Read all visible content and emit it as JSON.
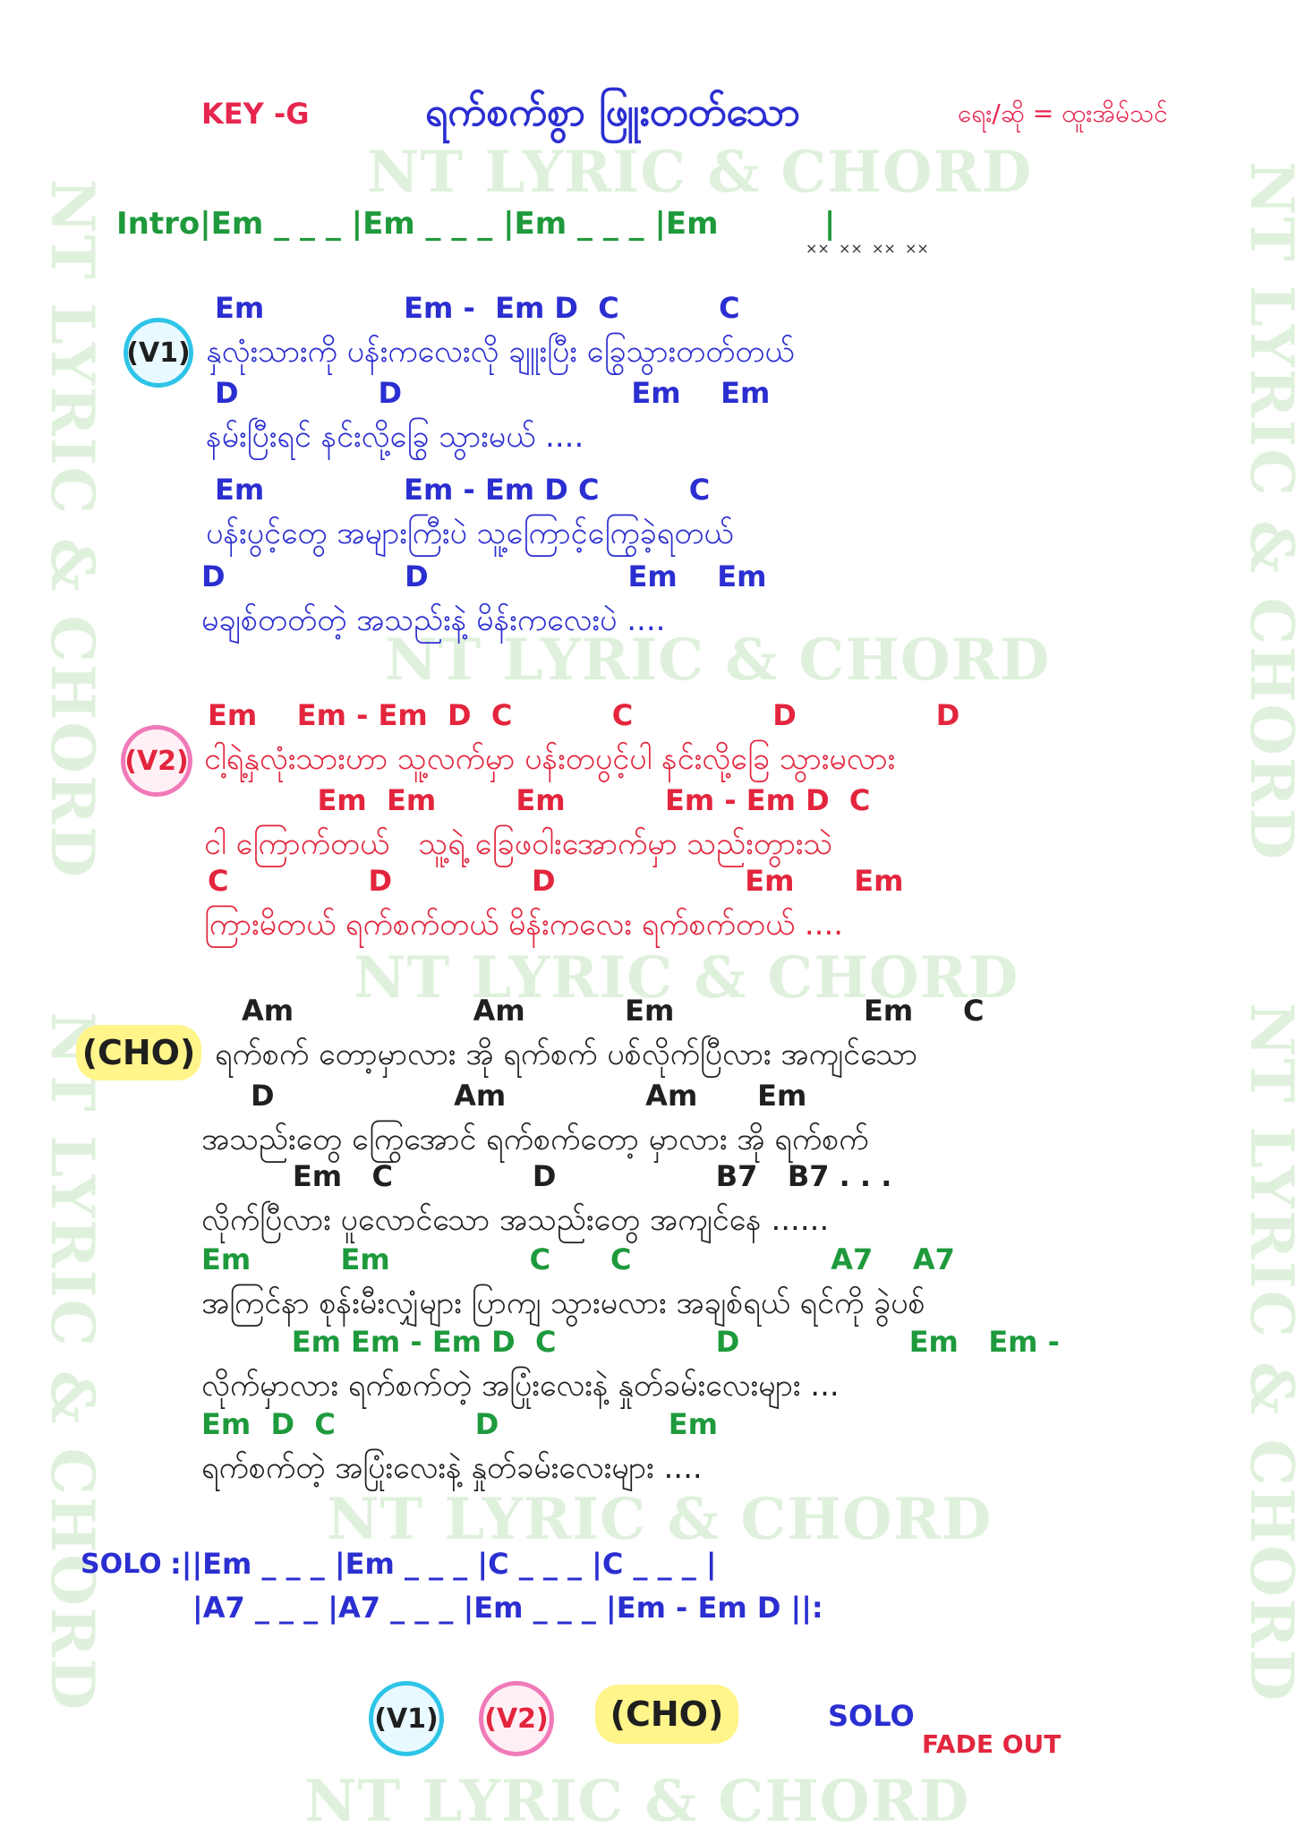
{
  "watermark": "NT LYRIC & CHORD",
  "header": {
    "key": "KEY -G",
    "title": "ရက်စက်စွာ ဖြူးတတ်သော",
    "credit": "ရေး/ဆို = ထူးအိမ်သင်"
  },
  "intro": {
    "line": "Intro|Em _ _ _ |Em _ _ _ |Em _ _ _ |Em          |"
  },
  "verse1": {
    "label": "(V1)",
    "lines": [
      {
        "chords": "Em              Em -  Em D  C          C",
        "lyric": "နှလုံးသားကို ပန်းကလေးလို ချူးပြီး ခြွေသွားတတ်တယ်"
      },
      {
        "chords": "D              D                       Em    Em",
        "lyric": "နမ်းပြီးရင် နင်းလို့ခြွေ သွားမယ် ...."
      },
      {
        "chords": "Em              Em - Em D C         C",
        "lyric": "ပန်းပွင့်တွေ အများကြီးပဲ သူ့ကြောင့်ကြွေခဲ့ရတယ်"
      },
      {
        "chords": "D                  D                    Em    Em",
        "lyric": "မချစ်တတ်တဲ့ အသည်းနဲ့ မိန်းကလေးပဲ ...."
      }
    ]
  },
  "verse2": {
    "label": "(V2)",
    "lines": [
      {
        "chords": "Em    Em - Em  D  C          C              D              D",
        "lyric": "ငါ့ရဲ့နှလုံးသားဟာ သူ့လက်မှာ ပန်းတပွင့်ပါ နင်းလို့ခြေ သွားမလား"
      },
      {
        "chords": "           Em  Em        Em          Em - Em D  C",
        "lyric": "ငါ ကြောက်တယ်   သူ့ရဲ့ ခြေဖဝါးအောက်မှာ သည်းတွားသဲ"
      },
      {
        "chords": "C              D              D                   Em      Em",
        "lyric": "ကြားမိတယ် ရက်စက်တယ် မိန်းကလေး ရက်စက်တယ် ...."
      }
    ]
  },
  "chorus": {
    "label": "(CHO)",
    "lines": [
      {
        "chords": "Am                  Am          Em                   Em     C",
        "lyric": "ရက်စက် တော့မှာလား အို ရက်စက် ပစ်လိုက်ပြီလား အကျင်သော",
        "color": "dark"
      },
      {
        "chords": "D                  Am              Am      Em",
        "lyric": "အသည်းတွေ ကြွေအောင် ရက်စက်တော့ မှာလား အို ရက်စက်",
        "color": "dark"
      },
      {
        "chords": "      Em   C              D                B7   B7 . . .",
        "lyric": "လိုက်ပြီလား ပူလောင်သော အသည်းတွေ အကျင်နေ ......",
        "color": "dark"
      },
      {
        "chords": "Em         Em              C      C                    A7    A7",
        "lyric": "အကြင်နာ စုန်းမီးလျှံများ ပြာကျ သွားမလား အချစ်ရယ် ရင်ကို ခွဲပစ်",
        "color": "green"
      },
      {
        "chords": "     Em Em - Em D  C                D                 Em   Em -",
        "lyric": "လိုက်မှာလား ရက်စက်တဲ့ အပြုံးလေးနဲ့ နှုတ်ခမ်းလေးများ ...",
        "color": "green"
      },
      {
        "chords": "Em  D  C              D                 Em",
        "lyric": "ရက်စက်တဲ့ အပြုံးလေးနဲ့ နှုတ်ခမ်းလေးများ ....",
        "color": "green"
      }
    ]
  },
  "solo": {
    "label": "SOLO",
    "line1": ":||Em _ _ _ |Em _ _ _ |C _ _ _ |C _ _ _ |",
    "line2": "|A7 _ _ _ |A7 _ _ _ |Em _ _ _ |Em - Em D ||:"
  },
  "order": {
    "v1": "(V1)",
    "v2": "(V2)",
    "cho": "(CHO)",
    "solo": "SOLO",
    "fade": "FADE OUT"
  },
  "colors": {
    "blue": "#2b2ed0",
    "red": "#e3253d",
    "green": "#1e9a3c",
    "yellow": "#fff58a",
    "cyan": "#2ec4e8",
    "pink": "#f07ab8",
    "watermark": "#dff1dc"
  }
}
